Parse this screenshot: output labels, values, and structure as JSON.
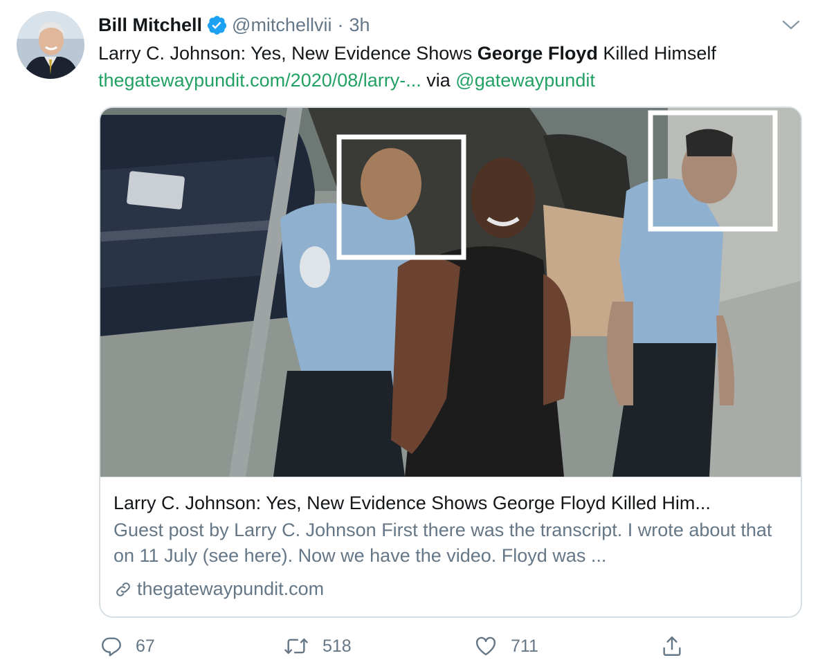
{
  "tweet": {
    "author_name": "Bill Mitchell",
    "handle": "@mitchellvii",
    "separator": "·",
    "time": "3h",
    "text_before": "Larry C. Johnson: Yes, New Evidence Shows ",
    "text_bold": "George Floyd",
    "text_after": " Killed Himself",
    "link_text": "thegatewaypundit.com/2020/08/larry-...",
    "via_text": " via ",
    "via_handle": "@gatewaypundit"
  },
  "card": {
    "title": "Larry C. Johnson: Yes, New Evidence Shows George Floyd Killed Him...",
    "description": "Guest post by Larry C. Johnson First there was the transcript. I wrote about that on 11 July (see here). Now we have the video. Floyd was ...",
    "domain": "thegatewaypundit.com"
  },
  "actions": {
    "replies": "67",
    "retweets": "518",
    "likes": "711"
  },
  "icons": {
    "verified": "verified-badge-icon",
    "caret": "chevron-down-icon",
    "reply": "reply-icon",
    "retweet": "retweet-icon",
    "like": "heart-icon",
    "share": "share-icon",
    "link": "link-icon"
  },
  "colors": {
    "accent_link": "#22a164",
    "verified": "#1da1f2",
    "secondary_text": "#657786"
  }
}
